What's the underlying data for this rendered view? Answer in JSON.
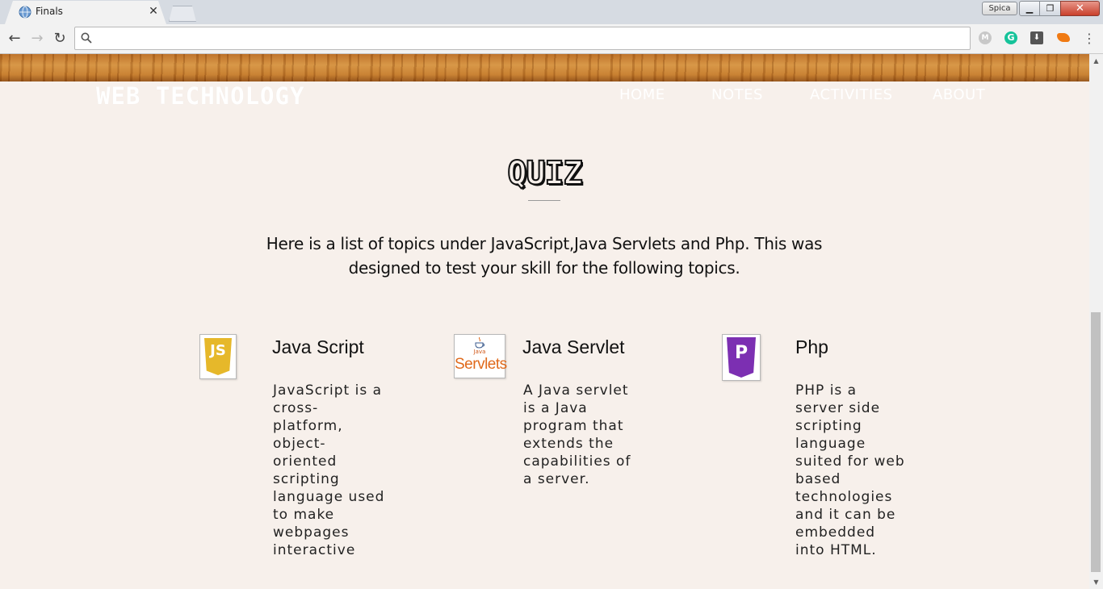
{
  "browser": {
    "tab_title": "Finals",
    "tab_close": "✕",
    "profile_name": "Spica",
    "window_min": "▁",
    "window_max": "❐",
    "window_close": "✕",
    "address_placeholder": "",
    "address_value": "",
    "nav_back": "←",
    "nav_forward": "→",
    "nav_reload": "↻",
    "menu": "⋮",
    "ext_m_label": "M",
    "ext_g_label": "G",
    "ext_d_label": "⬇"
  },
  "site": {
    "brand": "WEB  TECHNOLOGY",
    "nav": [
      "HOME",
      "NOTES",
      "ACTIVITIES",
      "ABOUT"
    ],
    "accent_wood": "#c47a2b"
  },
  "quiz": {
    "title": "QUIZ",
    "intro": "Here is a list of topics under JavaScript,Java Servlets and Php. This was designed to test your skill for the following topics.",
    "topics": [
      {
        "title": "Java Script",
        "icon": "javascript-logo-icon",
        "icon_text": "JS",
        "description": "JavaScript is a cross-platform, object-oriented scripting language used to make webpages interactive"
      },
      {
        "title": "Java Servlet",
        "icon": "java-servlets-logo-icon",
        "icon_text": "Servlets",
        "icon_subtext": "Java",
        "description": "A Java servlet is a Java program that extends the capabilities of a server."
      },
      {
        "title": "Php",
        "icon": "php-logo-icon",
        "icon_text": "P",
        "description": "PHP is a server side scripting language suited for web based technologies and it can be embedded into HTML."
      }
    ]
  },
  "scrollbar": {
    "up": "▲",
    "down": "▼",
    "position_fraction": 0.6
  }
}
